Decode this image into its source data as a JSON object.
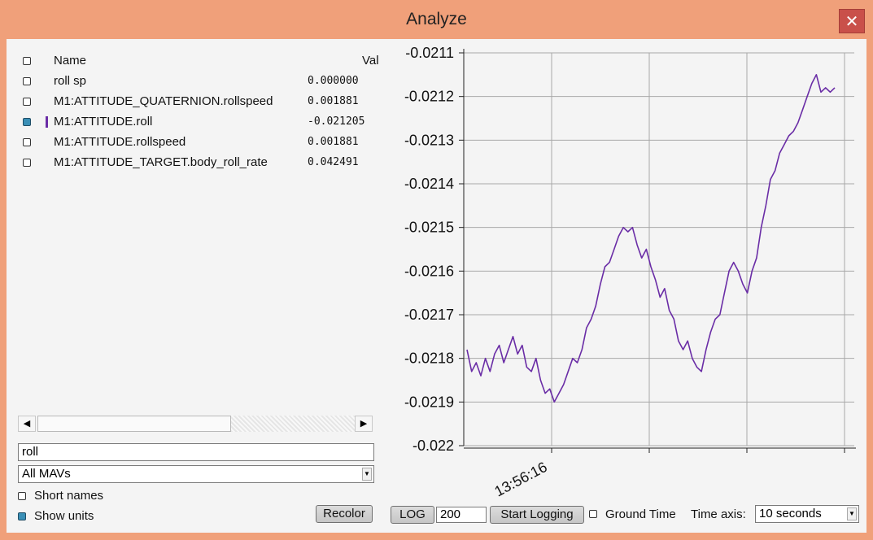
{
  "window": {
    "title": "Analyze",
    "close_glyph": "✕"
  },
  "list": {
    "header": {
      "name": "Name",
      "value": "Value"
    },
    "rows": [
      {
        "name": "roll sp",
        "value": "0.000000",
        "checked": false,
        "has_color": false
      },
      {
        "name": "M1:ATTITUDE_QUATERNION.rollspeed",
        "value": "0.001881",
        "checked": false,
        "has_color": false
      },
      {
        "name": "M1:ATTITUDE.roll",
        "value": "-0.021205",
        "checked": true,
        "has_color": true
      },
      {
        "name": "M1:ATTITUDE.rollspeed",
        "value": "0.001881",
        "checked": false,
        "has_color": false
      },
      {
        "name": "M1:ATTITUDE_TARGET.body_roll_rate",
        "value": "0.042491",
        "checked": false,
        "has_color": false
      }
    ],
    "series_color": "#6a2da6"
  },
  "scrollbar": {
    "left_glyph": "◀",
    "right_glyph": "▶"
  },
  "filter": {
    "value": "roll"
  },
  "mav_select": {
    "selected": "All MAVs",
    "arrow": "▼"
  },
  "options": {
    "short_names": "Short names",
    "show_units": "Show units"
  },
  "recolor": "Recolor",
  "bottom": {
    "log_label": "LOG",
    "log_count": "200",
    "start_logging": "Start Logging",
    "ground_time": "Ground Time",
    "time_axis_label": "Time axis:",
    "time_axis_value": "10 seconds",
    "arrow": "▼"
  },
  "chart_data": {
    "type": "line",
    "title": "",
    "xlabel": "",
    "ylabel": "",
    "ylim": [
      -0.022,
      -0.0211
    ],
    "yticks": [
      "-0.0211",
      "-0.0212",
      "-0.0213",
      "-0.0214",
      "-0.0215",
      "-0.0216",
      "-0.0217",
      "-0.0218",
      "-0.0219",
      "-0.022"
    ],
    "xtick_label": "13:56:16",
    "grid": true,
    "series": [
      {
        "color": "#6a2da6",
        "points": [
          [
            0,
            -0.02178
          ],
          [
            2,
            -0.02183
          ],
          [
            4,
            -0.02181
          ],
          [
            6,
            -0.02184
          ],
          [
            8,
            -0.0218
          ],
          [
            10,
            -0.02183
          ],
          [
            12,
            -0.02179
          ],
          [
            14,
            -0.02177
          ],
          [
            16,
            -0.02181
          ],
          [
            18,
            -0.02178
          ],
          [
            20,
            -0.02175
          ],
          [
            22,
            -0.02179
          ],
          [
            24,
            -0.02177
          ],
          [
            26,
            -0.02182
          ],
          [
            28,
            -0.02183
          ],
          [
            30,
            -0.0218
          ],
          [
            32,
            -0.02185
          ],
          [
            34,
            -0.02188
          ],
          [
            36,
            -0.02187
          ],
          [
            38,
            -0.0219
          ],
          [
            40,
            -0.02188
          ],
          [
            42,
            -0.02186
          ],
          [
            44,
            -0.02183
          ],
          [
            46,
            -0.0218
          ],
          [
            48,
            -0.02181
          ],
          [
            50,
            -0.02178
          ],
          [
            52,
            -0.02173
          ],
          [
            54,
            -0.02171
          ],
          [
            56,
            -0.02168
          ],
          [
            58,
            -0.02163
          ],
          [
            60,
            -0.02159
          ],
          [
            62,
            -0.02158
          ],
          [
            64,
            -0.02155
          ],
          [
            66,
            -0.02152
          ],
          [
            68,
            -0.0215
          ],
          [
            70,
            -0.02151
          ],
          [
            72,
            -0.0215
          ],
          [
            74,
            -0.02154
          ],
          [
            76,
            -0.02157
          ],
          [
            78,
            -0.02155
          ],
          [
            80,
            -0.02159
          ],
          [
            82,
            -0.02162
          ],
          [
            84,
            -0.02166
          ],
          [
            86,
            -0.02164
          ],
          [
            88,
            -0.02169
          ],
          [
            90,
            -0.02171
          ],
          [
            92,
            -0.02176
          ],
          [
            94,
            -0.02178
          ],
          [
            96,
            -0.02176
          ],
          [
            98,
            -0.0218
          ],
          [
            100,
            -0.02182
          ],
          [
            102,
            -0.02183
          ],
          [
            104,
            -0.02178
          ],
          [
            106,
            -0.02174
          ],
          [
            108,
            -0.02171
          ],
          [
            110,
            -0.0217
          ],
          [
            112,
            -0.02165
          ],
          [
            114,
            -0.0216
          ],
          [
            116,
            -0.02158
          ],
          [
            118,
            -0.0216
          ],
          [
            120,
            -0.02163
          ],
          [
            122,
            -0.02165
          ],
          [
            124,
            -0.0216
          ],
          [
            126,
            -0.02157
          ],
          [
            128,
            -0.0215
          ],
          [
            130,
            -0.02145
          ],
          [
            132,
            -0.02139
          ],
          [
            134,
            -0.02137
          ],
          [
            136,
            -0.02133
          ],
          [
            138,
            -0.02131
          ],
          [
            140,
            -0.02129
          ],
          [
            142,
            -0.02128
          ],
          [
            144,
            -0.02126
          ],
          [
            146,
            -0.02123
          ],
          [
            148,
            -0.0212
          ],
          [
            150,
            -0.02117
          ],
          [
            152,
            -0.02115
          ],
          [
            154,
            -0.02119
          ],
          [
            156,
            -0.02118
          ],
          [
            158,
            -0.02119
          ],
          [
            160,
            -0.02118
          ]
        ]
      }
    ]
  }
}
